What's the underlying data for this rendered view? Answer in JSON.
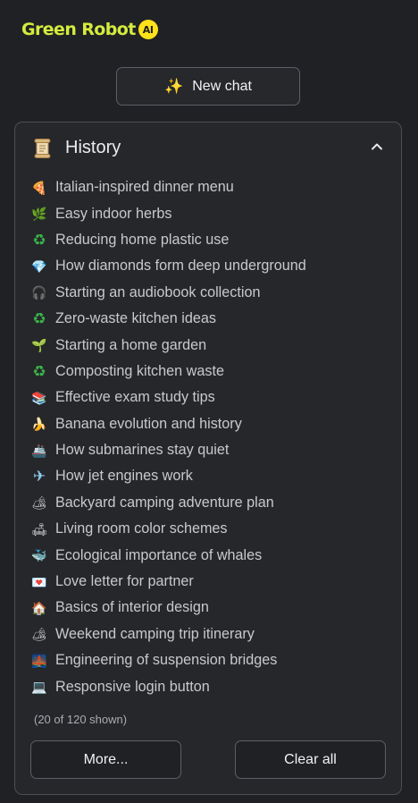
{
  "brand": {
    "name": "Green Robot",
    "badge": "AI"
  },
  "new_chat": {
    "label": "New chat",
    "icon": "sparkle-icon"
  },
  "history": {
    "title": "History",
    "icon": "scroll-icon",
    "collapse_icon": "chevron-up-icon",
    "items": [
      {
        "label": "Italian-inspired dinner menu",
        "icon": "pizza-icon",
        "glyph": "🍕"
      },
      {
        "label": "Easy indoor herbs",
        "icon": "herb-icon",
        "glyph": "🌿"
      },
      {
        "label": "Reducing home plastic use",
        "icon": "recycle-icon",
        "glyph": "♻"
      },
      {
        "label": "How diamonds form deep underground",
        "icon": "diamond-icon",
        "glyph": "💎"
      },
      {
        "label": "Starting an audiobook collection",
        "icon": "headphones-icon",
        "glyph": "🎧"
      },
      {
        "label": "Zero-waste kitchen ideas",
        "icon": "recycle-icon",
        "glyph": "♻"
      },
      {
        "label": "Starting a home garden",
        "icon": "seedling-icon",
        "glyph": "🌱"
      },
      {
        "label": "Composting kitchen waste",
        "icon": "recycle-icon",
        "glyph": "♻"
      },
      {
        "label": "Effective exam study tips",
        "icon": "books-icon",
        "glyph": "📚"
      },
      {
        "label": "Banana evolution and history",
        "icon": "banana-icon",
        "glyph": "🍌"
      },
      {
        "label": "How submarines stay quiet",
        "icon": "ship-icon",
        "glyph": "🚢"
      },
      {
        "label": "How jet engines work",
        "icon": "airplane-icon",
        "glyph": "✈"
      },
      {
        "label": "Backyard camping adventure plan",
        "icon": "camping-icon",
        "glyph": "🏕"
      },
      {
        "label": "Living room color schemes",
        "icon": "couch-icon",
        "glyph": "🛋"
      },
      {
        "label": "Ecological importance of whales",
        "icon": "whale-icon",
        "glyph": "🐳"
      },
      {
        "label": "Love letter for partner",
        "icon": "love-letter-icon",
        "glyph": "💌"
      },
      {
        "label": "Basics of interior design",
        "icon": "house-icon",
        "glyph": "🏠"
      },
      {
        "label": "Weekend camping trip itinerary",
        "icon": "camping-icon",
        "glyph": "🏕"
      },
      {
        "label": "Engineering of suspension bridges",
        "icon": "bridge-icon",
        "glyph": "🌉"
      },
      {
        "label": "Responsive login button",
        "icon": "laptop-icon",
        "glyph": "💻"
      }
    ],
    "shown_text": "(20 of 120 shown)",
    "more_label": "More...",
    "clear_label": "Clear all"
  },
  "colors": {
    "background": "#202124",
    "panel": "#26272b",
    "brand_text": "#d4ec3e",
    "brand_badge": "#ffe21a",
    "recycle": "#3bb54a"
  }
}
